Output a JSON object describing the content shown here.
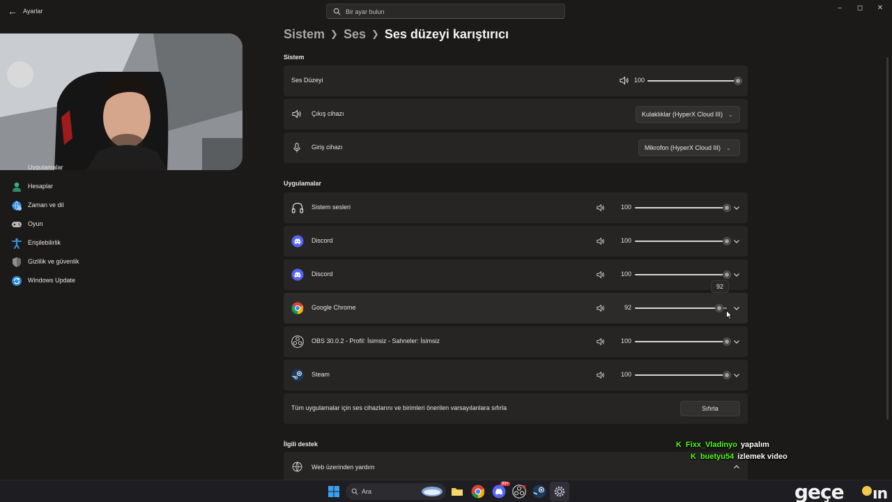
{
  "window": {
    "title": "Ayarlar"
  },
  "search": {
    "placeholder": "Bir ayar bulun"
  },
  "sidebar": {
    "items": [
      {
        "label": "Uygulamalar",
        "icon": "apps-icon"
      },
      {
        "label": "Hesaplar",
        "icon": "account-icon"
      },
      {
        "label": "Zaman ve dil",
        "icon": "globe-clock-icon"
      },
      {
        "label": "Oyun",
        "icon": "gamepad-icon"
      },
      {
        "label": "Erişilebilirlik",
        "icon": "accessibility-icon"
      },
      {
        "label": "Gizlilik ve güvenlik",
        "icon": "shield-icon"
      },
      {
        "label": "Windows Update",
        "icon": "update-icon"
      }
    ]
  },
  "breadcrumb": {
    "level1": "Sistem",
    "level2": "Ses",
    "current": "Ses düzeyi karıştırıcı"
  },
  "system_section": {
    "heading": "Sistem",
    "master_volume": {
      "label": "Ses Düzeyi",
      "value": "100",
      "level": 1.0
    },
    "output": {
      "label": "Çıkış cihazı",
      "device": "Kulaklıklar (HyperX Cloud III)"
    },
    "input": {
      "label": "Giriş cihazı",
      "device": "Mikrofon (HyperX Cloud III)"
    }
  },
  "apps_section": {
    "heading": "Uygulamalar",
    "apps": [
      {
        "name": "Sistem sesleri",
        "value": "100",
        "level": 1.0,
        "icon": "headphones-icon"
      },
      {
        "name": "Discord",
        "value": "100",
        "level": 1.0,
        "icon": "discord-icon"
      },
      {
        "name": "Discord",
        "value": "100",
        "level": 1.0,
        "icon": "discord-icon"
      },
      {
        "name": "Google Chrome",
        "value": "92",
        "level": 0.92,
        "icon": "chrome-icon"
      },
      {
        "name": "OBS 30.0.2 - Profil: İsimsiz - Sahneler: İsimsiz",
        "value": "100",
        "level": 1.0,
        "icon": "obs-icon"
      },
      {
        "name": "Steam",
        "value": "100",
        "level": 1.0,
        "icon": "steam-icon"
      }
    ],
    "slider_tooltip": "92",
    "reset": {
      "label": "Tüm uygulamalar için ses cihazlarını ve birimleri önerilen varsayılanlara sıfırla",
      "button": "Sıfırla"
    }
  },
  "support_section": {
    "heading": "İlgili destek",
    "web_help": "Web üzerinden yardım"
  },
  "chat": [
    {
      "user": "Fixx_Vladinyo",
      "message": "yapalım"
    },
    {
      "user": "buetyu54",
      "message": "izlemek video"
    }
  ],
  "taskbar": {
    "search_label": "Ara",
    "discord_badge": "99+"
  },
  "colors": {
    "accent_discord": "#5865f2",
    "chat_green": "#53fc18",
    "background": "#1c1a19",
    "card": "#272524"
  }
}
